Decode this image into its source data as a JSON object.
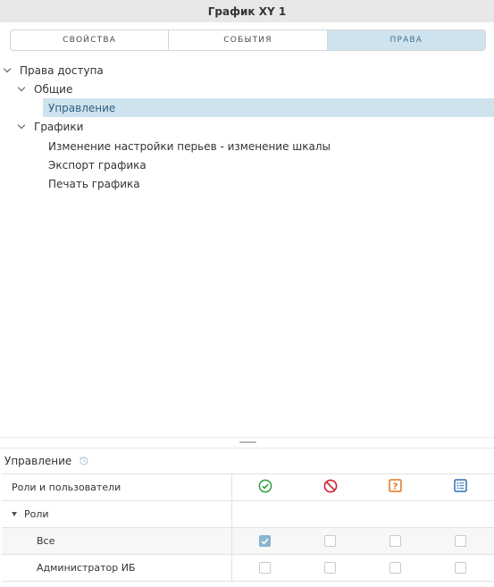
{
  "window": {
    "title": "График XY 1"
  },
  "tabs": [
    {
      "label": "СВОЙСТВА",
      "active": false
    },
    {
      "label": "СОБЫТИЯ",
      "active": false
    },
    {
      "label": "ПРАВА",
      "active": true
    }
  ],
  "tree": {
    "root": "Права доступа",
    "general": "Общие",
    "management": "Управление",
    "charts": "Графики",
    "items": [
      "Изменение настройки перьев - изменение шкалы",
      "Экспорт графика",
      "Печать графика"
    ]
  },
  "permissions": {
    "section_title": "Управление",
    "header_label": "Роли и пользователи",
    "columns": [
      {
        "icon": "check-circle-icon",
        "color": "#2e9b3a"
      },
      {
        "icon": "deny-circle-icon",
        "color": "#d0202a"
      },
      {
        "icon": "question-square-icon",
        "color": "#e0761f"
      },
      {
        "icon": "list-square-icon",
        "color": "#2f6fb5"
      }
    ],
    "group_label": "Роли",
    "rows": [
      {
        "label": "Все",
        "values": [
          true,
          false,
          false,
          false
        ]
      },
      {
        "label": "Администратор ИБ",
        "values": [
          false,
          false,
          false,
          false
        ]
      }
    ]
  },
  "colors": {
    "selection": "#cfe3ee",
    "titlebar": "#e8e8e8",
    "checked": "#8ab3cf"
  }
}
